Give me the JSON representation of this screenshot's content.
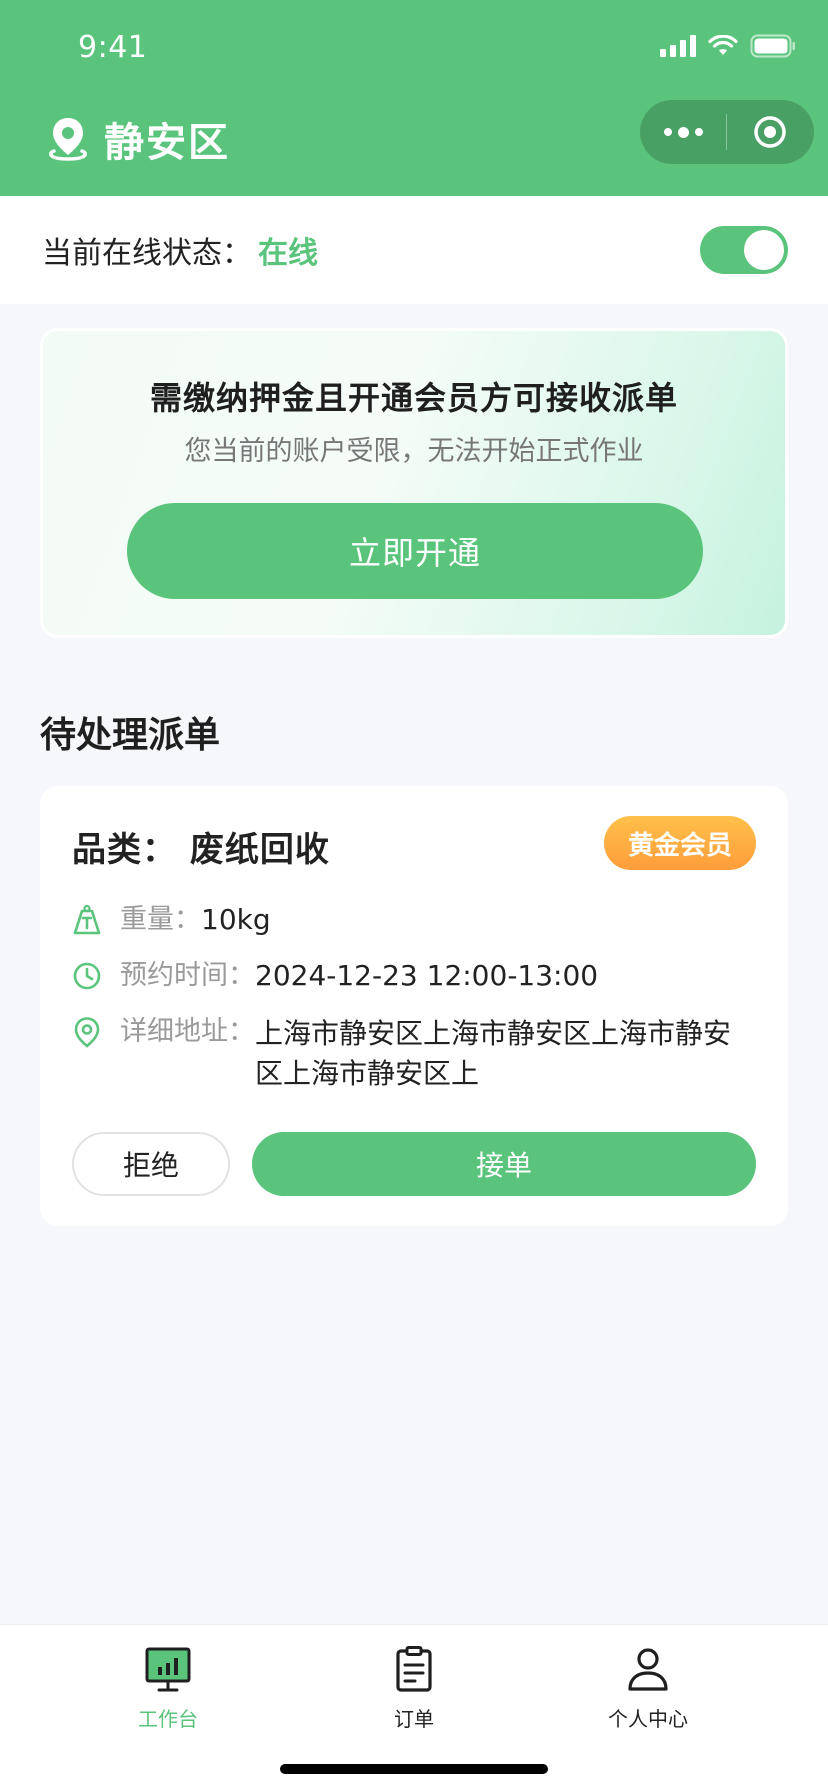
{
  "status_bar": {
    "time": "9:41"
  },
  "header": {
    "location": "静安区"
  },
  "online": {
    "label": "当前在线状态：",
    "value": "在线",
    "toggle_on": true
  },
  "promo": {
    "title": "需缴纳押金且开通会员方可接收派单",
    "subtitle": "您当前的账户受限，无法开始正式作业",
    "button": "立即开通"
  },
  "section": {
    "title": "待处理派单"
  },
  "order": {
    "category": "品类：  废纸回收",
    "badge": "黄金会员",
    "weight_key": "重量：",
    "weight_val": "10kg",
    "time_key": "预约时间：",
    "time_val": "2024-12-23 12:00-13:00",
    "addr_key": "详细地址：",
    "addr_val": "上海市静安区上海市静安区上海市静安区上海市静安区上",
    "reject": "拒绝",
    "accept": "接单"
  },
  "tabs": [
    {
      "label": "工作台",
      "active": true
    },
    {
      "label": "订单",
      "active": false
    },
    {
      "label": "个人中心",
      "active": false
    }
  ],
  "colors": {
    "brand": "#5ac47c",
    "badge": "#ffa93f",
    "background": "#f6f7fb"
  }
}
